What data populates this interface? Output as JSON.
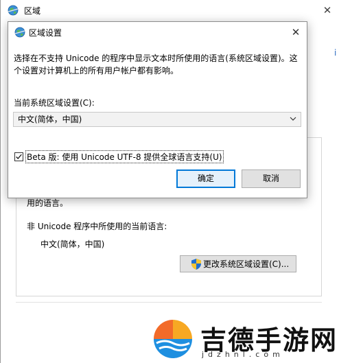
{
  "parent_window": {
    "title": "区域",
    "edge_link_fragment": "i",
    "text_partial": "用的语言。",
    "non_unicode_label": "非 Unicode 程序中所使用的当前语言:",
    "current_language": "中文(简体，中国)",
    "change_button_label": "更改系统区域设置(C)..."
  },
  "dialog": {
    "title": "区域设置",
    "description": "选择在不支持 Unicode 的程序中显示文本时所使用的语言(系统区域设置)。这个设置对计算机上的所有用户帐户都有影响。",
    "current_locale_label": "当前系统区域设置(C):",
    "locale_value": "中文(简体，中国)",
    "beta_checkbox_label": "Beta 版: 使用 Unicode UTF-8 提供全球语言支持(U)",
    "beta_checked": true,
    "ok_label": "确定",
    "cancel_label": "取消"
  },
  "watermark": {
    "name": "吉德手游网",
    "domain": "jdzhnl.com"
  },
  "colors": {
    "accent": "#0078d7",
    "button_bg": "#e1e1e1",
    "select_bg": "#f2f2f2",
    "link": "#2a6bc1"
  },
  "icons": [
    "globe-icon",
    "close-icon",
    "chevron-down-icon",
    "checkmark-icon",
    "shield-icon",
    "logo-icon"
  ]
}
